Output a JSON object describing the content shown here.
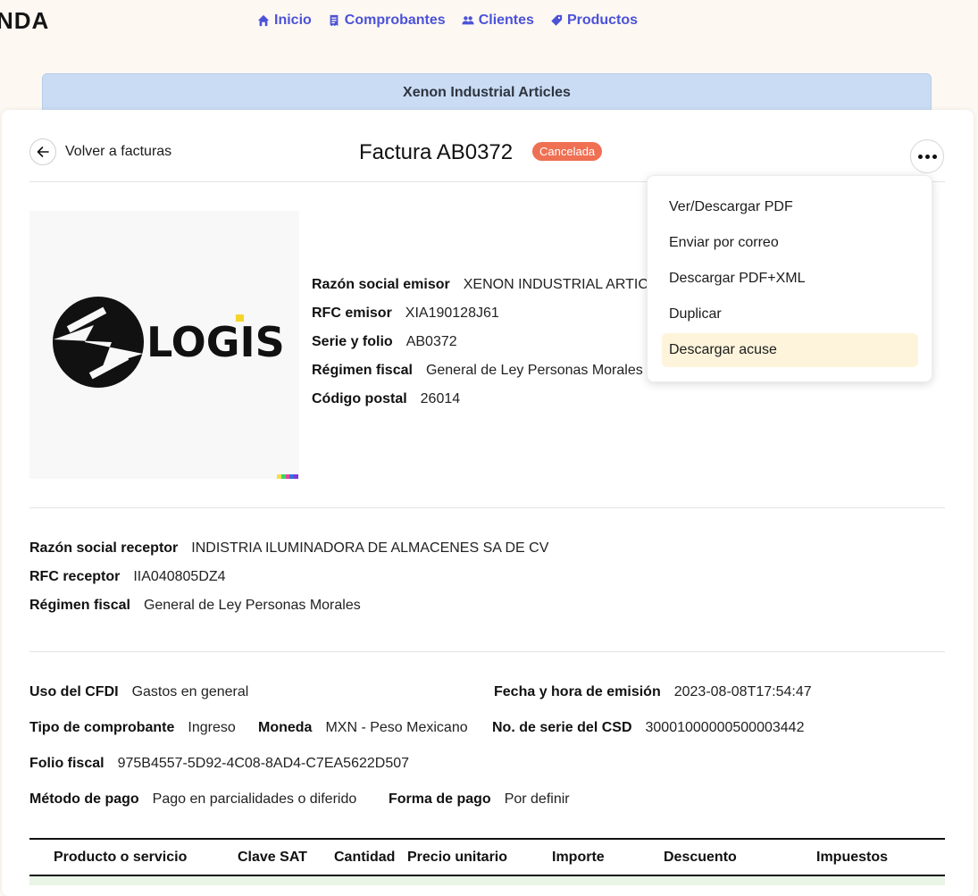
{
  "brand": "NDA",
  "nav": [
    {
      "label": "Inicio",
      "icon": "home-icon"
    },
    {
      "label": "Comprobantes",
      "icon": "receipt-icon"
    },
    {
      "label": "Clientes",
      "icon": "users-icon"
    },
    {
      "label": "Productos",
      "icon": "tag-icon"
    }
  ],
  "company_name": "Xenon Industrial Articles",
  "header": {
    "back_label": "Volver a facturas",
    "title": "Factura AB0372",
    "status": "Cancelada"
  },
  "logo": {
    "text": "LOGIS"
  },
  "emisor": {
    "razon_social_label": "Razón social emisor",
    "razon_social_value": "XENON INDUSTRIAL ARTICLES",
    "rfc_label": "RFC emisor",
    "rfc_value": "XIA190128J61",
    "serie_label": "Serie y folio",
    "serie_value": "AB0372",
    "regimen_label": "Régimen fiscal",
    "regimen_value": "General de Ley Personas Morales",
    "cp_label": "Código postal",
    "cp_value": "26014"
  },
  "menu": {
    "items": [
      "Ver/Descargar PDF",
      "Enviar por correo",
      "Descargar PDF+XML",
      "Duplicar",
      "Descargar acuse"
    ],
    "active_index": 4
  },
  "receptor": {
    "razon_social_label": "Razón social receptor",
    "razon_social_value": "INDISTRIA ILUMINADORA DE ALMACENES SA DE CV",
    "rfc_label": "RFC receptor",
    "rfc_value": "IIA040805DZ4",
    "regimen_label": "Régimen fiscal",
    "regimen_value": "General de Ley Personas Morales"
  },
  "comprobante": {
    "uso_label": "Uso del CFDI",
    "uso_value": "Gastos en general",
    "fecha_label": "Fecha y hora de emisión",
    "fecha_value": "2023-08-08T17:54:47",
    "tipo_label": "Tipo de comprobante",
    "tipo_value": "Ingreso",
    "moneda_label": "Moneda",
    "moneda_value": "MXN - Peso Mexicano",
    "csd_label": "No. de serie del CSD",
    "csd_value": "30001000000500003442",
    "folio_label": "Folio fiscal",
    "folio_value": "975B4557-5D92-4C08-8AD4-C7EA5622D507",
    "metodo_label": "Método de pago",
    "metodo_value": "Pago en parcialidades o diferido",
    "forma_label": "Forma de pago",
    "forma_value": "Por definir"
  },
  "table": {
    "headers": [
      "Producto o servicio",
      "Clave SAT",
      "Cantidad",
      "Precio unitario",
      "Importe",
      "Descuento",
      "Impuestos"
    ]
  },
  "colors": {
    "accent": "#4b52d8",
    "status_badge": "#ef7053",
    "company_bar": "#c9dcf3",
    "menu_highlight": "#fdf4db"
  }
}
